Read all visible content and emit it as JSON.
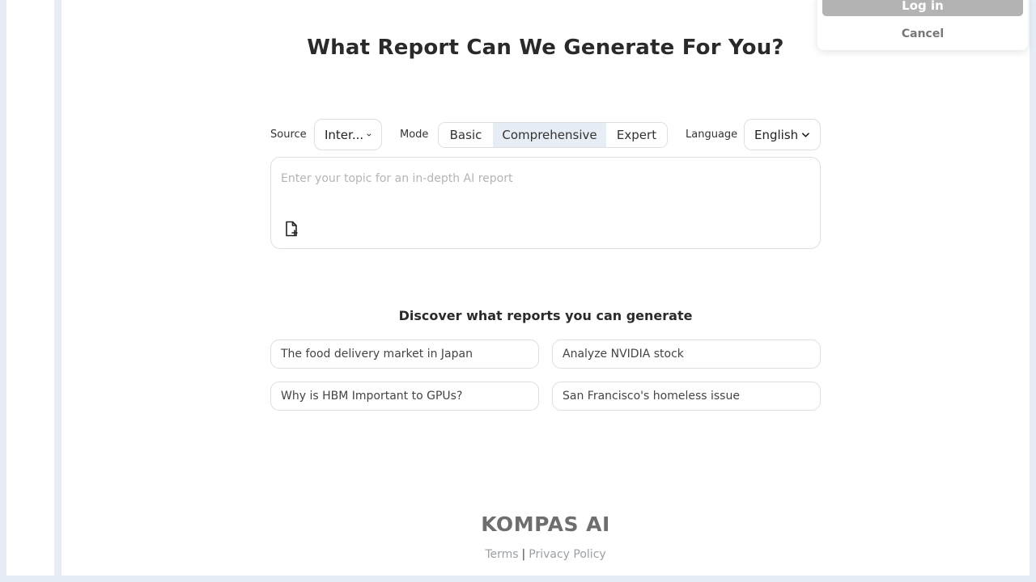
{
  "page": {
    "title": "What Report Can We Generate For You?"
  },
  "controls": {
    "source_label": "Source",
    "source_value": "Inter...",
    "mode_label": "Mode",
    "modes": [
      {
        "label": "Basic",
        "active": false
      },
      {
        "label": "Comprehensive",
        "active": true
      },
      {
        "label": "Expert",
        "active": false
      }
    ],
    "language_label": "Language",
    "language_value": "English"
  },
  "topic": {
    "placeholder": "Enter your topic for an in-depth AI report",
    "value": "",
    "attach_icon": "file-plus-icon"
  },
  "discover": {
    "title": "Discover what reports you can generate",
    "suggestions": [
      "The food delivery market in Japan",
      "Analyze NVIDIA stock",
      "Why is HBM Important to GPUs?",
      "San Francisco's homeless issue"
    ]
  },
  "footer": {
    "logo": "KOMPAS AI",
    "terms": "Terms",
    "separator": "|",
    "privacy": "Privacy Policy"
  },
  "login_popup": {
    "login_label": "Log in",
    "cancel_label": "Cancel"
  },
  "colors": {
    "page_bg": "#e6edf5",
    "active_mode_bg": "#e7edf5",
    "login_button_bg": "#b3b3b3",
    "logo_accent": "#e8744a"
  }
}
